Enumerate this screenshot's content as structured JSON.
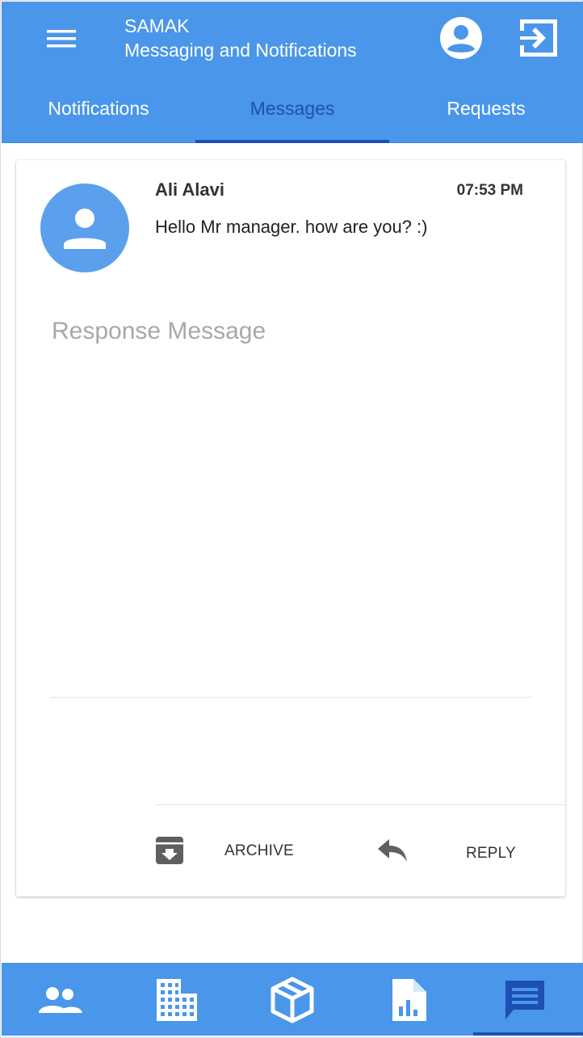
{
  "header": {
    "app_name": "SAMAK",
    "subtitle": "Messaging and Notifications",
    "menu_icon": "hamburger-menu-icon",
    "account_icon": "account-circle-icon",
    "logout_icon": "exit-to-app-icon"
  },
  "tabs": [
    {
      "label": "Notifications",
      "active": false
    },
    {
      "label": "Messages",
      "active": true
    },
    {
      "label": "Requests",
      "active": false
    }
  ],
  "message": {
    "sender": "Ali Alavi",
    "time": "07:53 PM",
    "text": "Hello Mr manager. how are you? :)",
    "avatar_icon": "person-icon"
  },
  "response": {
    "placeholder": "Response Message",
    "value": ""
  },
  "actions": {
    "archive_label": "ARCHIVE",
    "archive_icon": "archive-icon",
    "reply_label": "REPLY",
    "reply_icon": "reply-icon"
  },
  "bottom_nav": [
    {
      "icon": "people-icon",
      "active": false
    },
    {
      "icon": "building-icon",
      "active": false
    },
    {
      "icon": "package-icon",
      "active": false
    },
    {
      "icon": "report-chart-icon",
      "active": false
    },
    {
      "icon": "message-icon",
      "active": true
    }
  ],
  "colors": {
    "primary": "#4a96ea",
    "accent": "#1e4fb5",
    "avatar_bg": "#5aa0ec"
  }
}
